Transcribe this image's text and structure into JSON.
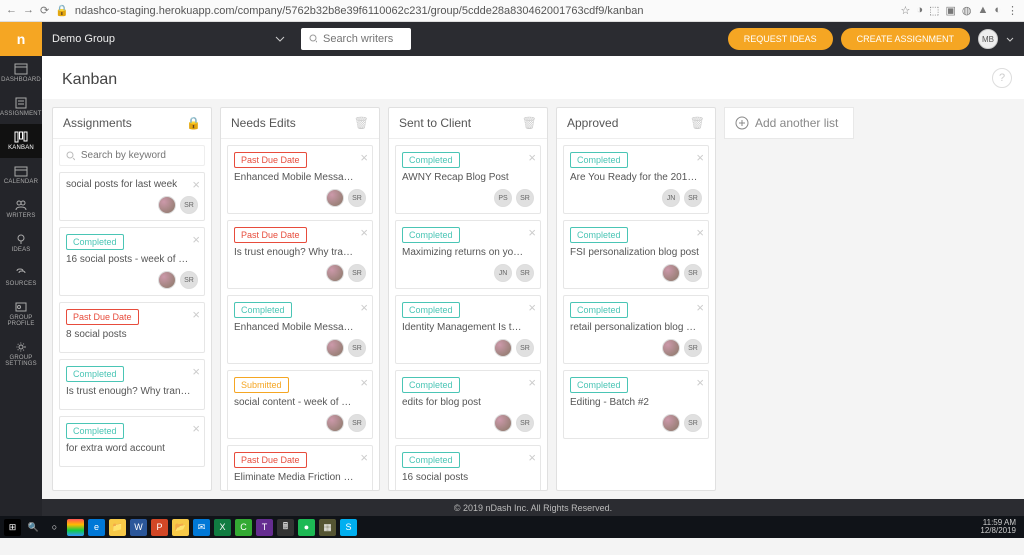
{
  "chrome": {
    "url": "ndashco-staging.herokuapp.com/company/5762b32b8e39f6110062c231/group/5cdde28a830462001763cdf9/kanban"
  },
  "topbar": {
    "group_name": "Demo Group",
    "search_placeholder": "Search writers",
    "request_ideas": "REQUEST IDEAS",
    "create_assignment": "CREATE ASSIGNMENT",
    "user_initials": "MB"
  },
  "sidebar": {
    "items": [
      {
        "label": "DASHBOARD"
      },
      {
        "label": "ASSIGNMENTS"
      },
      {
        "label": "KANBAN"
      },
      {
        "label": "CALENDAR"
      },
      {
        "label": "WRITERS"
      },
      {
        "label": "IDEAS"
      },
      {
        "label": "SOURCES"
      },
      {
        "label": "GROUP PROFILE"
      },
      {
        "label": "GROUP SETTINGS"
      }
    ]
  },
  "page_title": "Kanban",
  "board": {
    "add_list_label": "Add another list",
    "lists": [
      {
        "title": "Assignments",
        "header_icon": "lock",
        "search_placeholder": "Search by keyword",
        "cards": [
          {
            "title": "social posts for last week",
            "members": [
              "photo",
              "SR"
            ]
          },
          {
            "status": "Completed",
            "status_class": "status-completed",
            "title": "16 social posts - week of …",
            "members": [
              "photo",
              "SR"
            ]
          },
          {
            "status": "Past Due Date",
            "status_class": "status-past",
            "title": "8 social posts"
          },
          {
            "status": "Completed",
            "status_class": "status-completed",
            "title": "Is trust enough? Why tran…"
          },
          {
            "status": "Completed",
            "status_class": "status-completed",
            "title": "for extra word account"
          }
        ]
      },
      {
        "title": "Needs Edits",
        "header_icon": "trash",
        "cards": [
          {
            "status": "Past Due Date",
            "status_class": "status-past",
            "title": "Enhanced Mobile Messa…",
            "members": [
              "photo",
              "SR"
            ]
          },
          {
            "status": "Past Due Date",
            "status_class": "status-past",
            "title": "Is trust enough? Why tra…",
            "members": [
              "photo",
              "SR"
            ]
          },
          {
            "status": "Completed",
            "status_class": "status-completed",
            "title": "Enhanced Mobile Messa…",
            "members": [
              "photo",
              "SR"
            ]
          },
          {
            "status": "Submitted",
            "status_class": "status-submitted",
            "title": "social content - week of …",
            "members": [
              "photo",
              "SR"
            ]
          },
          {
            "status": "Past Due Date",
            "status_class": "status-past",
            "title": "Eliminate Media Friction …"
          }
        ]
      },
      {
        "title": "Sent to Client",
        "header_icon": "trash",
        "cards": [
          {
            "status": "Completed",
            "status_class": "status-completed",
            "title": "AWNY Recap Blog Post",
            "members": [
              "PS",
              "SR"
            ]
          },
          {
            "status": "Completed",
            "status_class": "status-completed",
            "title": "Maximizing returns on yo…",
            "members": [
              "JN",
              "SR"
            ]
          },
          {
            "status": "Completed",
            "status_class": "status-completed",
            "title": "Identity Management Is t…",
            "members": [
              "photo",
              "SR"
            ]
          },
          {
            "status": "Completed",
            "status_class": "status-completed",
            "title": "edits for blog post",
            "members": [
              "photo",
              "SR"
            ]
          },
          {
            "status": "Completed",
            "status_class": "status-completed",
            "title": "16 social posts"
          }
        ]
      },
      {
        "title": "Approved",
        "header_icon": "trash",
        "cards": [
          {
            "status": "Completed",
            "status_class": "status-completed",
            "title": "Are You Ready for the 2019…",
            "members": [
              "JN",
              "SR"
            ]
          },
          {
            "status": "Completed",
            "status_class": "status-completed",
            "title": "FSI personalization blog post",
            "members": [
              "photo",
              "SR"
            ]
          },
          {
            "status": "Completed",
            "status_class": "status-completed",
            "title": "retail personalization blog …",
            "members": [
              "photo",
              "SR"
            ]
          },
          {
            "status": "Completed",
            "status_class": "status-completed",
            "title": "Editing - Batch #2",
            "members": [
              "photo",
              "SR"
            ]
          }
        ]
      }
    ]
  },
  "footer": "© 2019 nDash Inc. All Rights Reserved.",
  "taskbar": {
    "time": "11:59 AM",
    "date": "12/8/2019"
  }
}
